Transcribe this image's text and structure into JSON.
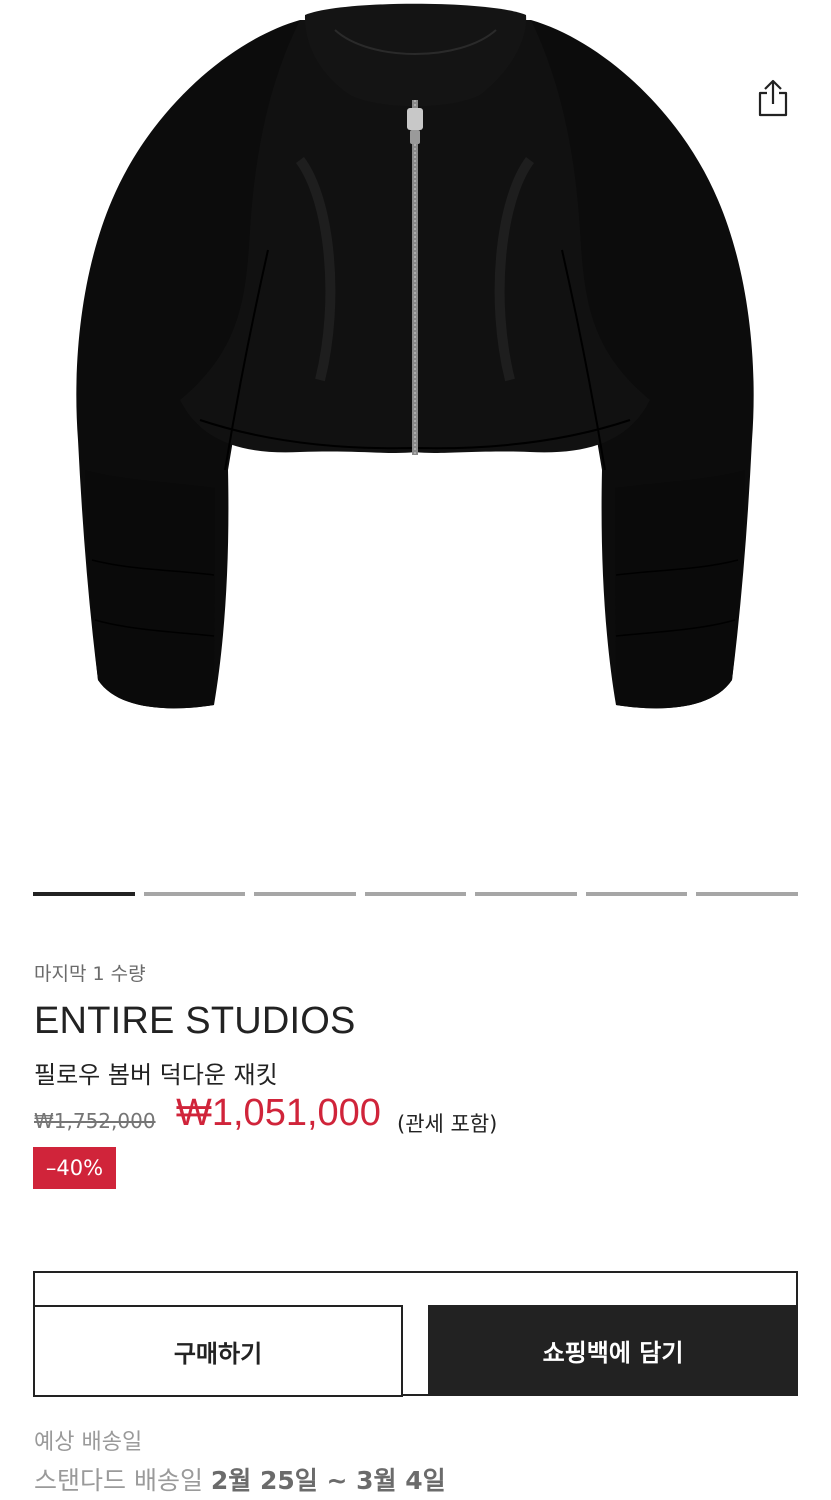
{
  "product_image": {
    "icon": "black-cropped-puffer-bomber-jacket"
  },
  "share": {
    "icon": "share-icon"
  },
  "carousel": {
    "count": 7,
    "active_index": 0
  },
  "product": {
    "stock_note": "마지막 1 수량",
    "brand": "ENTIRE STUDIOS",
    "name": "필로우 봄버 덕다운 재킷",
    "original_price": "₩1,752,000",
    "sale_price": "₩1,051,000",
    "tax_note": "(관세 포함)",
    "discount": "–40%"
  },
  "actions": {
    "buy_label": "구매하기",
    "bag_label": "쇼핑백에 담기"
  },
  "shipping": {
    "label": "예상 배송일",
    "standard_prefix": "스탠다드 배송일",
    "standard_dates": "2월 25일 ~ 3월 4일"
  },
  "colors": {
    "sale": "#d0243a",
    "primary": "#222222",
    "muted": "#9a9a9a"
  }
}
